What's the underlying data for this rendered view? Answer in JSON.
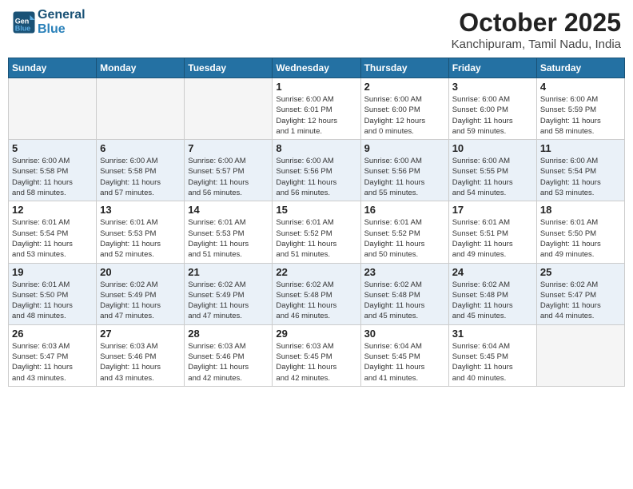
{
  "logo": {
    "line1": "General",
    "line2": "Blue"
  },
  "title": "October 2025",
  "subtitle": "Kanchipuram, Tamil Nadu, India",
  "weekdays": [
    "Sunday",
    "Monday",
    "Tuesday",
    "Wednesday",
    "Thursday",
    "Friday",
    "Saturday"
  ],
  "weeks": [
    [
      {
        "day": "",
        "info": ""
      },
      {
        "day": "",
        "info": ""
      },
      {
        "day": "",
        "info": ""
      },
      {
        "day": "1",
        "info": "Sunrise: 6:00 AM\nSunset: 6:01 PM\nDaylight: 12 hours\nand 1 minute."
      },
      {
        "day": "2",
        "info": "Sunrise: 6:00 AM\nSunset: 6:00 PM\nDaylight: 12 hours\nand 0 minutes."
      },
      {
        "day": "3",
        "info": "Sunrise: 6:00 AM\nSunset: 6:00 PM\nDaylight: 11 hours\nand 59 minutes."
      },
      {
        "day": "4",
        "info": "Sunrise: 6:00 AM\nSunset: 5:59 PM\nDaylight: 11 hours\nand 58 minutes."
      }
    ],
    [
      {
        "day": "5",
        "info": "Sunrise: 6:00 AM\nSunset: 5:58 PM\nDaylight: 11 hours\nand 58 minutes."
      },
      {
        "day": "6",
        "info": "Sunrise: 6:00 AM\nSunset: 5:58 PM\nDaylight: 11 hours\nand 57 minutes."
      },
      {
        "day": "7",
        "info": "Sunrise: 6:00 AM\nSunset: 5:57 PM\nDaylight: 11 hours\nand 56 minutes."
      },
      {
        "day": "8",
        "info": "Sunrise: 6:00 AM\nSunset: 5:56 PM\nDaylight: 11 hours\nand 56 minutes."
      },
      {
        "day": "9",
        "info": "Sunrise: 6:00 AM\nSunset: 5:56 PM\nDaylight: 11 hours\nand 55 minutes."
      },
      {
        "day": "10",
        "info": "Sunrise: 6:00 AM\nSunset: 5:55 PM\nDaylight: 11 hours\nand 54 minutes."
      },
      {
        "day": "11",
        "info": "Sunrise: 6:00 AM\nSunset: 5:54 PM\nDaylight: 11 hours\nand 53 minutes."
      }
    ],
    [
      {
        "day": "12",
        "info": "Sunrise: 6:01 AM\nSunset: 5:54 PM\nDaylight: 11 hours\nand 53 minutes."
      },
      {
        "day": "13",
        "info": "Sunrise: 6:01 AM\nSunset: 5:53 PM\nDaylight: 11 hours\nand 52 minutes."
      },
      {
        "day": "14",
        "info": "Sunrise: 6:01 AM\nSunset: 5:53 PM\nDaylight: 11 hours\nand 51 minutes."
      },
      {
        "day": "15",
        "info": "Sunrise: 6:01 AM\nSunset: 5:52 PM\nDaylight: 11 hours\nand 51 minutes."
      },
      {
        "day": "16",
        "info": "Sunrise: 6:01 AM\nSunset: 5:52 PM\nDaylight: 11 hours\nand 50 minutes."
      },
      {
        "day": "17",
        "info": "Sunrise: 6:01 AM\nSunset: 5:51 PM\nDaylight: 11 hours\nand 49 minutes."
      },
      {
        "day": "18",
        "info": "Sunrise: 6:01 AM\nSunset: 5:50 PM\nDaylight: 11 hours\nand 49 minutes."
      }
    ],
    [
      {
        "day": "19",
        "info": "Sunrise: 6:01 AM\nSunset: 5:50 PM\nDaylight: 11 hours\nand 48 minutes."
      },
      {
        "day": "20",
        "info": "Sunrise: 6:02 AM\nSunset: 5:49 PM\nDaylight: 11 hours\nand 47 minutes."
      },
      {
        "day": "21",
        "info": "Sunrise: 6:02 AM\nSunset: 5:49 PM\nDaylight: 11 hours\nand 47 minutes."
      },
      {
        "day": "22",
        "info": "Sunrise: 6:02 AM\nSunset: 5:48 PM\nDaylight: 11 hours\nand 46 minutes."
      },
      {
        "day": "23",
        "info": "Sunrise: 6:02 AM\nSunset: 5:48 PM\nDaylight: 11 hours\nand 45 minutes."
      },
      {
        "day": "24",
        "info": "Sunrise: 6:02 AM\nSunset: 5:48 PM\nDaylight: 11 hours\nand 45 minutes."
      },
      {
        "day": "25",
        "info": "Sunrise: 6:02 AM\nSunset: 5:47 PM\nDaylight: 11 hours\nand 44 minutes."
      }
    ],
    [
      {
        "day": "26",
        "info": "Sunrise: 6:03 AM\nSunset: 5:47 PM\nDaylight: 11 hours\nand 43 minutes."
      },
      {
        "day": "27",
        "info": "Sunrise: 6:03 AM\nSunset: 5:46 PM\nDaylight: 11 hours\nand 43 minutes."
      },
      {
        "day": "28",
        "info": "Sunrise: 6:03 AM\nSunset: 5:46 PM\nDaylight: 11 hours\nand 42 minutes."
      },
      {
        "day": "29",
        "info": "Sunrise: 6:03 AM\nSunset: 5:45 PM\nDaylight: 11 hours\nand 42 minutes."
      },
      {
        "day": "30",
        "info": "Sunrise: 6:04 AM\nSunset: 5:45 PM\nDaylight: 11 hours\nand 41 minutes."
      },
      {
        "day": "31",
        "info": "Sunrise: 6:04 AM\nSunset: 5:45 PM\nDaylight: 11 hours\nand 40 minutes."
      },
      {
        "day": "",
        "info": ""
      }
    ]
  ]
}
